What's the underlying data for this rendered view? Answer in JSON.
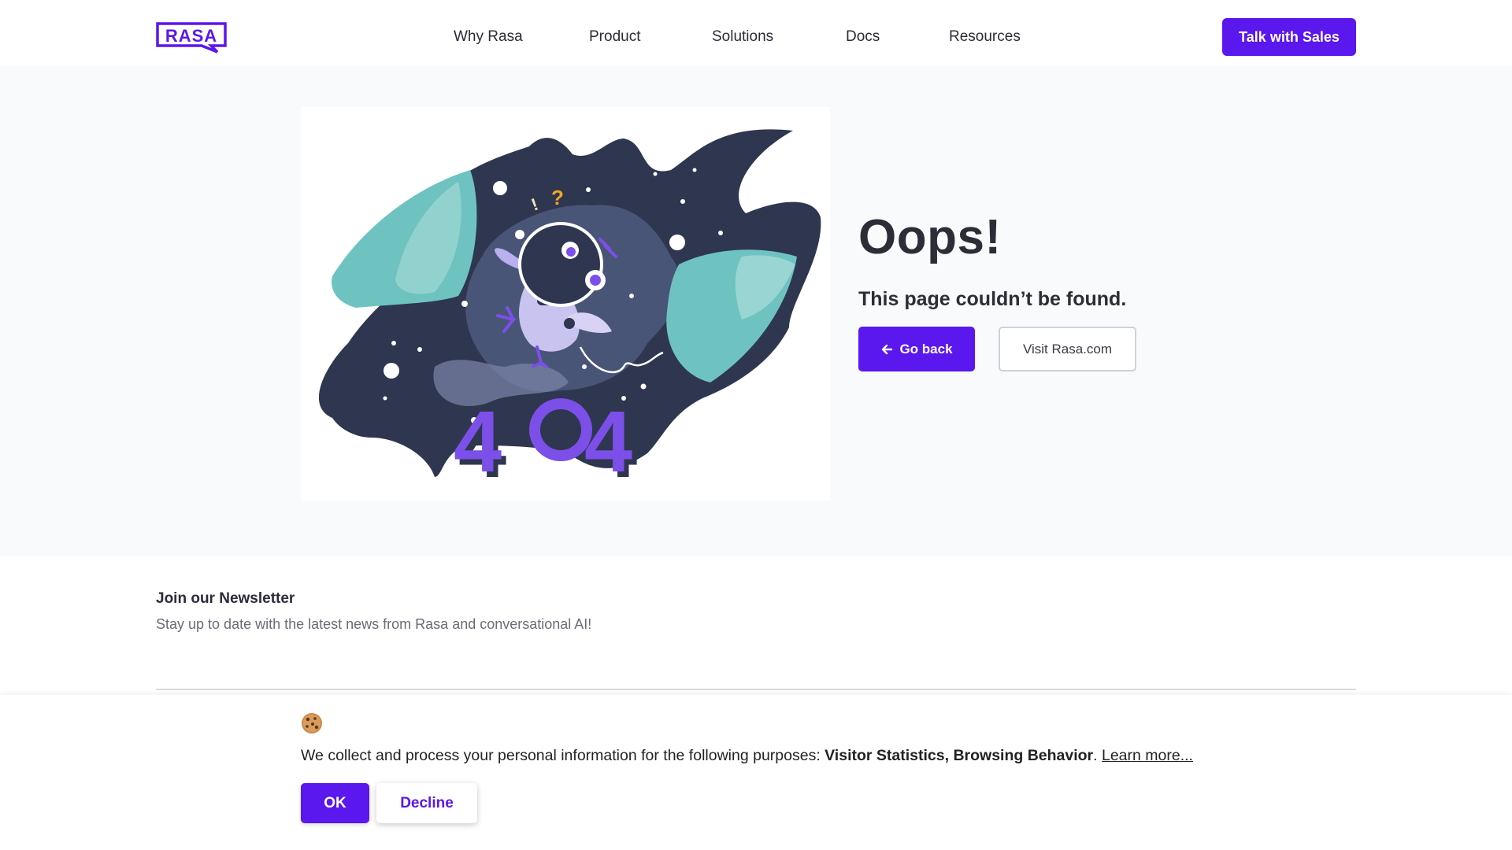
{
  "header": {
    "logo_text": "RASA",
    "nav": [
      "Why Rasa",
      "Product",
      "Solutions",
      "Docs",
      "Resources"
    ],
    "cta_label": "Talk with Sales"
  },
  "error_page": {
    "illustration_text": "404",
    "title": "Oops!",
    "message": "This page couldn’t be found.",
    "back_label": "Go back",
    "visit_label": "Visit Rasa.com"
  },
  "newsletter": {
    "title": "Join our Newsletter",
    "subtitle": "Stay up to date with the latest news from Rasa and conversational AI!"
  },
  "cookie_banner": {
    "icon": "cookie-icon",
    "text_prefix": "We collect and process your personal information for the following purposes: ",
    "purposes": "Visitor Statistics, Browsing Behavior",
    "text_suffix": ". ",
    "learn_more": "Learn more...",
    "ok_label": "OK",
    "decline_label": "Decline"
  },
  "colors": {
    "brand": "#5a17ee",
    "hero_bg": "#f9fafc",
    "text": "#2d2d38",
    "space_dark": "#2e3650",
    "planet_teal": "#6ec3c0"
  }
}
